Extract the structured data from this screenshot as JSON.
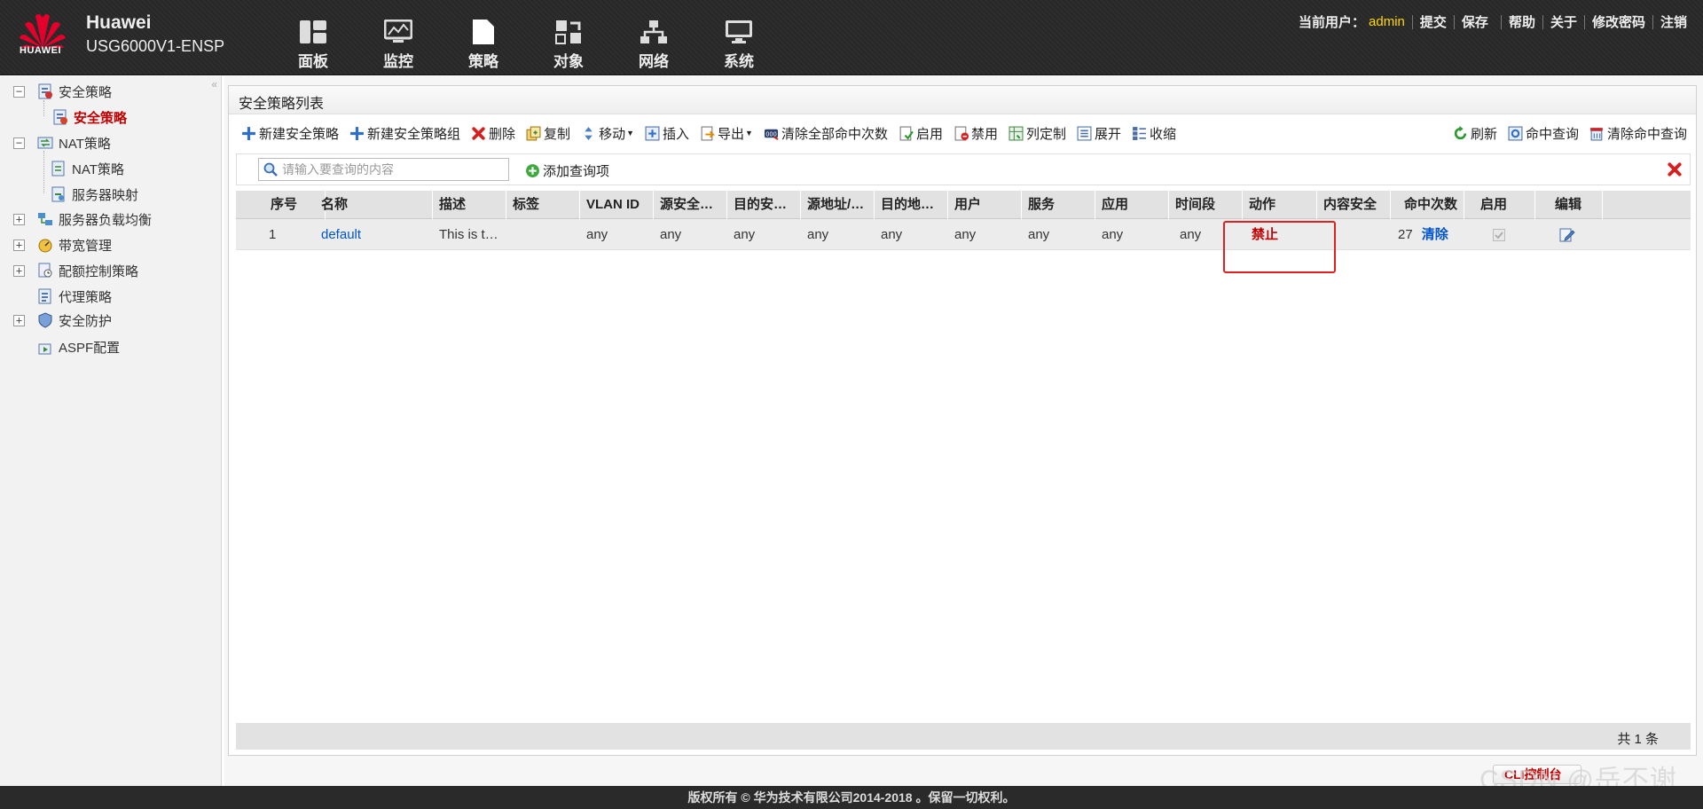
{
  "header": {
    "logo_text": "HUAWEI",
    "brand_line1": "Huawei",
    "brand_line2": "USG6000V1-ENSP",
    "nav": [
      {
        "label": "面板",
        "icon": "dashboard-icon"
      },
      {
        "label": "监控",
        "icon": "monitor-icon"
      },
      {
        "label": "策略",
        "icon": "policy-icon",
        "active": true
      },
      {
        "label": "对象",
        "icon": "object-icon"
      },
      {
        "label": "网络",
        "icon": "network-icon"
      },
      {
        "label": "系统",
        "icon": "system-icon"
      }
    ],
    "current_user_label": "当前用户：",
    "current_user": "admin",
    "links": {
      "submit": "提交",
      "save": "保存",
      "help": "帮助",
      "about": "关于",
      "change_password": "修改密码",
      "logout": "注销"
    }
  },
  "sidebar": {
    "items": [
      {
        "label": "安全策略",
        "icon": "security-policy-icon",
        "toggle": "−"
      },
      {
        "label": "安全策略",
        "icon": "policy-doc-icon",
        "selected": true
      },
      {
        "label": "NAT策略",
        "icon": "nat-icon",
        "toggle": "−"
      },
      {
        "label": "NAT策略",
        "icon": "nat-policy-icon"
      },
      {
        "label": "服务器映射",
        "icon": "server-map-icon"
      },
      {
        "label": "服务器负载均衡",
        "icon": "load-balance-icon",
        "toggle": "+"
      },
      {
        "label": "带宽管理",
        "icon": "bandwidth-icon",
        "toggle": "+"
      },
      {
        "label": "配额控制策略",
        "icon": "quota-icon",
        "toggle": "+"
      },
      {
        "label": "代理策略",
        "icon": "proxy-icon"
      },
      {
        "label": "安全防护",
        "icon": "shield-icon",
        "toggle": "+"
      },
      {
        "label": "ASPF配置",
        "icon": "aspf-icon"
      }
    ]
  },
  "panel": {
    "title": "安全策略列表",
    "toolbar": {
      "new_policy": "新建安全策略",
      "new_group": "新建安全策略组",
      "delete": "删除",
      "copy": "复制",
      "move": "移动",
      "insert": "插入",
      "export": "导出",
      "clear_all_hits": "清除全部命中次数",
      "enable": "启用",
      "disable": "禁用",
      "customize_columns": "列定制",
      "expand": "展开",
      "collapse": "收缩",
      "refresh": "刷新",
      "hit_query": "命中查询",
      "clear_hit_query": "清除命中查询"
    },
    "search": {
      "placeholder": "请输入要查询的内容",
      "add_query": "添加查询项"
    },
    "table": {
      "columns": [
        "序号",
        "名称",
        "描述",
        "标签",
        "VLAN ID",
        "源安全…",
        "目的安…",
        "源地址/…",
        "目的地…",
        "用户",
        "服务",
        "应用",
        "时间段",
        "动作",
        "内容安全",
        "命中次数",
        "启用",
        "编辑"
      ],
      "rows": [
        {
          "seq": "1",
          "name": "default",
          "desc": "This is t…",
          "tag": "",
          "vlan": "any",
          "src_zone": "any",
          "dst_zone": "any",
          "src_addr": "any",
          "dst_addr": "any",
          "user": "any",
          "service": "any",
          "app": "any",
          "time": "any",
          "action": "禁止",
          "content_security": "",
          "hits": "27",
          "clear": "清除",
          "enabled": true
        }
      ]
    },
    "total": "共 1 条"
  },
  "console_button": "CLI控制台",
  "watermark": "CSDN @岳不谢",
  "copyright": "版权所有 © 华为技术有限公司2014-2018 。保留一切权利。"
}
